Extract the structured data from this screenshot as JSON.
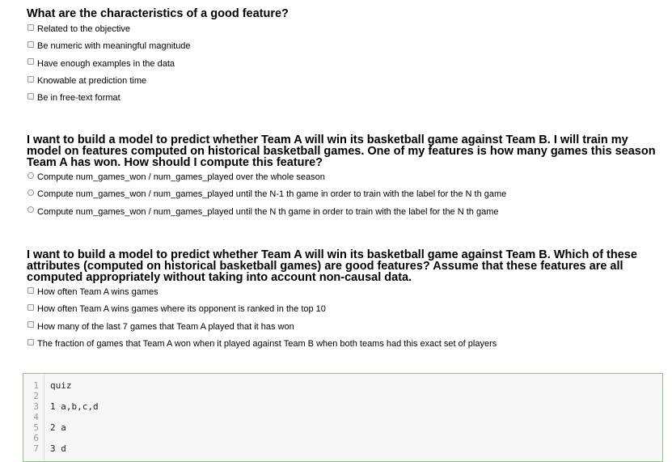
{
  "questions": [
    {
      "title": "What are the characteristics of a good feature?",
      "type": "checkbox",
      "options": [
        "Related to the objective",
        "Be numeric with meaningful magnitude",
        "Have enough examples in the data",
        "Knowable at prediction time",
        "Be in free-text format"
      ]
    },
    {
      "title_lines": [
        "I want to build a model to predict whether Team A will win its basketball game against Team B. I will train my",
        "model on features computed on historical basketball games. One of my features is how many games this season",
        "Team A has won. How should I compute this feature?"
      ],
      "type": "radio",
      "options": [
        "Compute num_games_won / num_games_played over the whole season",
        "Compute num_games_won / num_games_played until the N-1 th game in order to train with the label for the N th game",
        "Compute num_games_won / num_games_played until the N th game in order to train with the label for the N th game"
      ]
    },
    {
      "title_lines": [
        "I want to build a model to predict whether Team A will win its basketball game against Team B. Which of these",
        "attributes (computed on historical basketball games) are good features? Assume that these features are all",
        "computed appropriately without taking into account non-causal data."
      ],
      "type": "checkbox",
      "options": [
        "How often Team A wins games",
        "How often Team A wins games where its opponent is ranked in the top 10",
        "How many of the last 7 games that Team A played that it has won",
        "The fraction of games that Team A won when it played against Team B when both teams had this exact set of players"
      ]
    }
  ],
  "editor": {
    "line_numbers": [
      "1",
      "2",
      "3",
      "4",
      "5",
      "6",
      "7"
    ],
    "lines": [
      "quiz",
      "",
      "1 a,b,c,d",
      "",
      "2 a",
      "",
      "3 d"
    ]
  }
}
